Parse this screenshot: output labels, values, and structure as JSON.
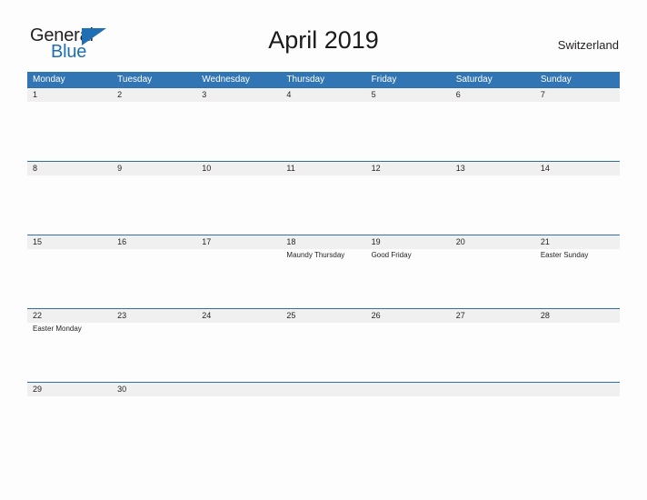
{
  "brand": {
    "name_part1": "General",
    "name_part2": "Blue",
    "triangle_color": "#1f6fb5"
  },
  "header": {
    "title": "April 2019",
    "region": "Switzerland"
  },
  "theme": {
    "header_blue": "#3175b4",
    "row_separator": "#2f6fab",
    "date_strip": "#f0f0f0",
    "page_background": "#fdfdfd",
    "text": "#231f20"
  },
  "calendar": {
    "weekday_headers": [
      "Monday",
      "Tuesday",
      "Wednesday",
      "Thursday",
      "Friday",
      "Saturday",
      "Sunday"
    ],
    "weeks": [
      [
        {
          "day": "1",
          "event": ""
        },
        {
          "day": "2",
          "event": ""
        },
        {
          "day": "3",
          "event": ""
        },
        {
          "day": "4",
          "event": ""
        },
        {
          "day": "5",
          "event": ""
        },
        {
          "day": "6",
          "event": ""
        },
        {
          "day": "7",
          "event": ""
        }
      ],
      [
        {
          "day": "8",
          "event": ""
        },
        {
          "day": "9",
          "event": ""
        },
        {
          "day": "10",
          "event": ""
        },
        {
          "day": "11",
          "event": ""
        },
        {
          "day": "12",
          "event": ""
        },
        {
          "day": "13",
          "event": ""
        },
        {
          "day": "14",
          "event": ""
        }
      ],
      [
        {
          "day": "15",
          "event": ""
        },
        {
          "day": "16",
          "event": ""
        },
        {
          "day": "17",
          "event": ""
        },
        {
          "day": "18",
          "event": "Maundy Thursday"
        },
        {
          "day": "19",
          "event": "Good Friday"
        },
        {
          "day": "20",
          "event": ""
        },
        {
          "day": "21",
          "event": "Easter Sunday"
        }
      ],
      [
        {
          "day": "22",
          "event": "Easter Monday"
        },
        {
          "day": "23",
          "event": ""
        },
        {
          "day": "24",
          "event": ""
        },
        {
          "day": "25",
          "event": ""
        },
        {
          "day": "26",
          "event": ""
        },
        {
          "day": "27",
          "event": ""
        },
        {
          "day": "28",
          "event": ""
        }
      ],
      [
        {
          "day": "29",
          "event": ""
        },
        {
          "day": "30",
          "event": ""
        },
        {
          "day": "",
          "event": ""
        },
        {
          "day": "",
          "event": ""
        },
        {
          "day": "",
          "event": ""
        },
        {
          "day": "",
          "event": ""
        },
        {
          "day": "",
          "event": ""
        }
      ]
    ]
  }
}
